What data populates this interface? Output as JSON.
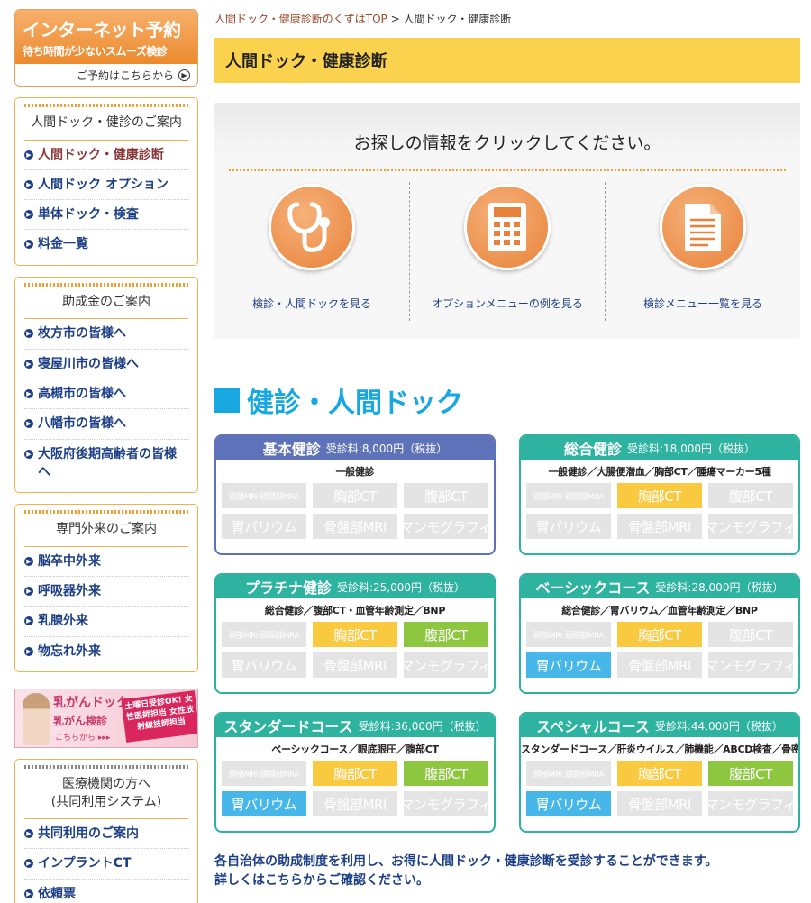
{
  "sidebar": {
    "reserve": {
      "title": "インターネット予約",
      "subtitle": "待ち時間が少ないスムーズ検診",
      "link": "ご予約はこちらから"
    },
    "sections": [
      {
        "heading": "人間ドック・健診のご案内",
        "items": [
          "人間ドック・健康診断",
          "人間ドック オプション",
          "単体ドック・検査",
          "料金一覧"
        ]
      },
      {
        "heading": "助成金のご案内",
        "items": [
          "枚方市の皆様へ",
          "寝屋川市の皆様へ",
          "高槻市の皆様へ",
          "八幡市の皆様へ",
          "大阪府後期高齢者の皆様へ"
        ]
      },
      {
        "heading": "専門外来のご案内",
        "items": [
          "脳卒中外来",
          "呼吸器外来",
          "乳腺外来",
          "物忘れ外来"
        ]
      },
      {
        "heading": "医療機関の方へ\n(共同利用システム)",
        "items": [
          "共同利用のご案内",
          "インプラントCT",
          "依頼票"
        ]
      }
    ],
    "banner": {
      "title": "乳がんドック",
      "sub": "乳がん検診",
      "more": "こちらから",
      "tag": "土曜日受診OK! 女性医師担当 女性放射線技師担当"
    }
  },
  "breadcrumb": {
    "home": "人間ドック・健康診断のくずはTOP",
    "sep": ">",
    "current": "人間ドック・健康診断"
  },
  "page_title": "人間ドック・健康診断",
  "pick": {
    "title": "お探しの情報をクリックしてください。",
    "items": [
      {
        "label": "検診・人間ドックを見る",
        "icon": "stethoscope-icon"
      },
      {
        "label": "オプションメニューの例を見る",
        "icon": "calculator-icon"
      },
      {
        "label": "検診メニュー一覧を見る",
        "icon": "document-icon"
      }
    ]
  },
  "section_title": "健診・人間ドック",
  "courses": [
    {
      "name": "基本健診",
      "fee": "受診料:8,000円（税抜）",
      "desc": "一般健診",
      "theme": "blue",
      "chips": [
        [
          "頭部MRI 頭頸部MRA",
          "none"
        ],
        [
          "胸部CT",
          "none"
        ],
        [
          "腹部CT",
          "none"
        ],
        [
          "胃バリウム",
          "none"
        ],
        [
          "骨盤部MRI",
          "none"
        ],
        [
          "マンモグラフィ",
          "none"
        ]
      ]
    },
    {
      "name": "総合健診",
      "fee": "受診料:18,000円（税抜）",
      "desc": "一般健診／大腸便潜血／胸部CT／腫瘍マーカー5種",
      "theme": "teal",
      "chips": [
        [
          "頭部MRI 頭頸部MRA",
          "none"
        ],
        [
          "胸部CT",
          "yellow"
        ],
        [
          "腹部CT",
          "none"
        ],
        [
          "胃バリウム",
          "none"
        ],
        [
          "骨盤部MRI",
          "none"
        ],
        [
          "マンモグラフィ",
          "none"
        ]
      ]
    },
    {
      "name": "プラチナ健診",
      "fee": "受診料:25,000円（税抜）",
      "desc": "総合健診／腹部CT・血管年齢測定／BNP",
      "theme": "teal",
      "chips": [
        [
          "頭部MRI 頭頸部MRA",
          "none"
        ],
        [
          "胸部CT",
          "yellow"
        ],
        [
          "腹部CT",
          "green"
        ],
        [
          "胃バリウム",
          "none"
        ],
        [
          "骨盤部MRI",
          "none"
        ],
        [
          "マンモグラフィ",
          "none"
        ]
      ]
    },
    {
      "name": "ベーシックコース",
      "fee": "受診料:28,000円（税抜）",
      "desc": "総合健診／胃バリウム／血管年齢測定／BNP",
      "theme": "teal",
      "chips": [
        [
          "頭部MRI 頭頸部MRA",
          "none"
        ],
        [
          "胸部CT",
          "yellow"
        ],
        [
          "腹部CT",
          "none"
        ],
        [
          "胃バリウム",
          "sky"
        ],
        [
          "骨盤部MRI",
          "none"
        ],
        [
          "マンモグラフィ",
          "none"
        ]
      ]
    },
    {
      "name": "スタンダードコース",
      "fee": "受診料:36,000円（税抜）",
      "desc": "ベーシックコース／眼底眼圧／腹部CT",
      "theme": "teal",
      "chips": [
        [
          "頭部MRI 頭頸部MRA",
          "none"
        ],
        [
          "胸部CT",
          "yellow"
        ],
        [
          "腹部CT",
          "green"
        ],
        [
          "胃バリウム",
          "sky"
        ],
        [
          "骨盤部MRI",
          "none"
        ],
        [
          "マンモグラフィ",
          "none"
        ]
      ]
    },
    {
      "name": "スペシャルコース",
      "fee": "受診料:44,000円（税抜）",
      "desc": "スタンダードコース／肝炎ウイルス／肺機能／ABCD検査／骨密度",
      "theme": "teal",
      "chips": [
        [
          "頭部MRI 頭頸部MRA",
          "none"
        ],
        [
          "胸部CT",
          "yellow"
        ],
        [
          "腹部CT",
          "green"
        ],
        [
          "胃バリウム",
          "sky"
        ],
        [
          "骨盤部MRI",
          "none"
        ],
        [
          "マンモグラフィ",
          "none"
        ]
      ]
    }
  ],
  "footer_note": [
    "各自治体の助成制度を利用し、お得に人間ドック・健康診断を受診することができます。",
    "詳しくはこちらからご確認ください。"
  ],
  "colors": {
    "accent": "#fbd24e",
    "teal": "#2db3a0",
    "blue": "#5d72b8",
    "link": "#1d3f86",
    "section": "#17a8e2"
  }
}
